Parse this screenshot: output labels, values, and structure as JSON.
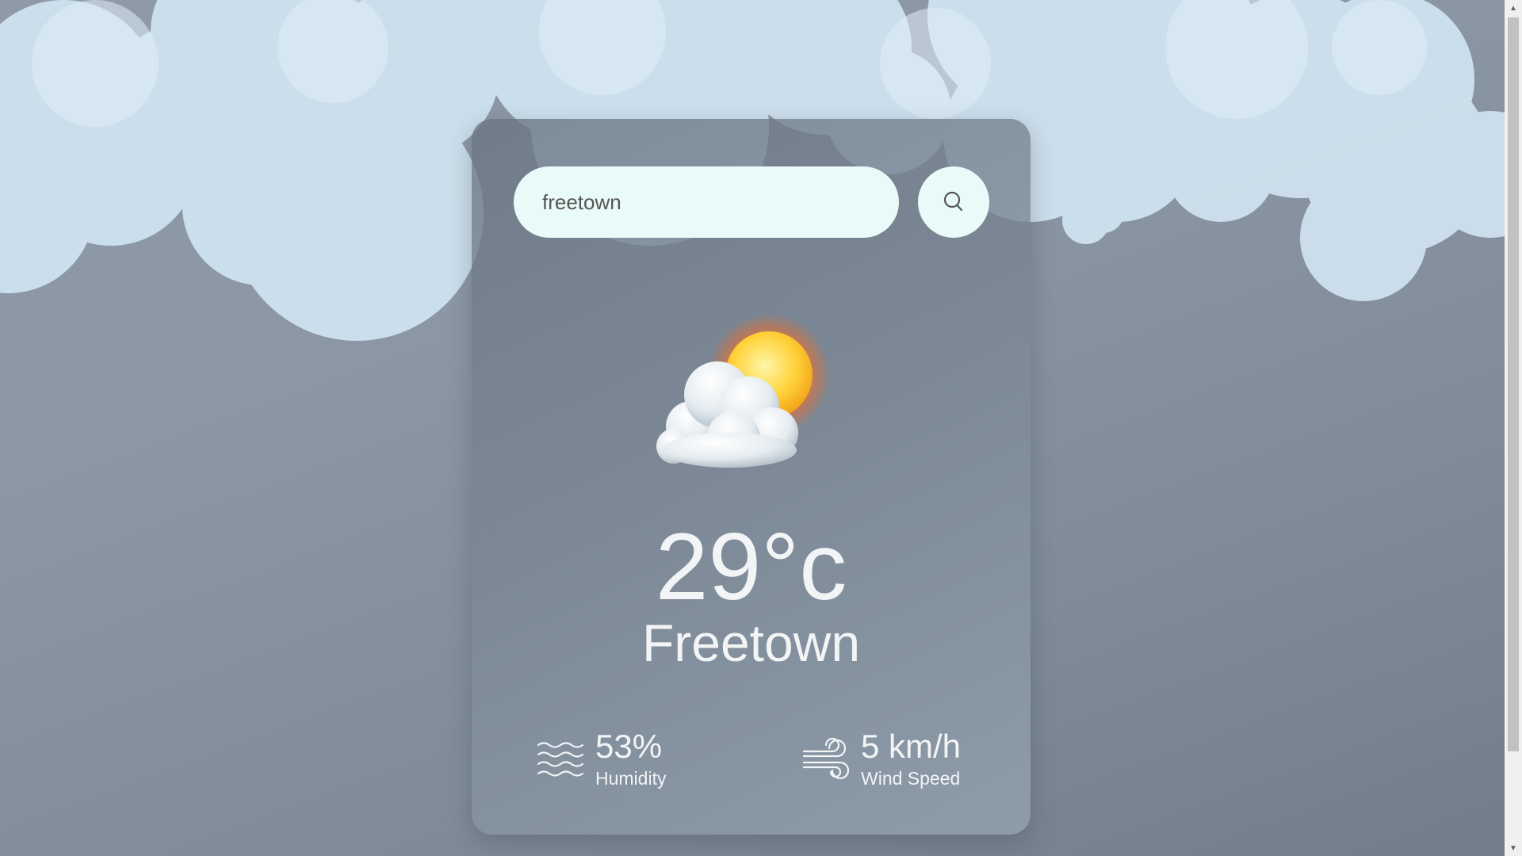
{
  "search": {
    "value": "freetown",
    "button_icon": "search-icon"
  },
  "weather": {
    "icon": "partly-cloudy-icon",
    "temperature": "29°c",
    "city": "Freetown"
  },
  "humidity": {
    "icon": "humidity-icon",
    "value": "53%",
    "label": "Humidity"
  },
  "wind": {
    "icon": "wind-icon",
    "value": "5 km/h",
    "label": "Wind Speed"
  },
  "colors": {
    "input_background": "#e9fbf8",
    "text": "#f2f4f6",
    "cloud": "#d3e5f1"
  }
}
